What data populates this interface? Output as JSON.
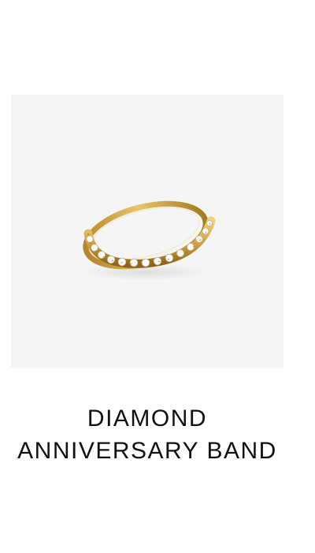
{
  "product": {
    "title_line_1": "DIAMOND",
    "title_line_2": "ANNIVERSARY BAND",
    "image": {
      "subject": "ring-icon",
      "metal_color": "#d4a63c",
      "background_color": "#f5f5f5"
    }
  }
}
